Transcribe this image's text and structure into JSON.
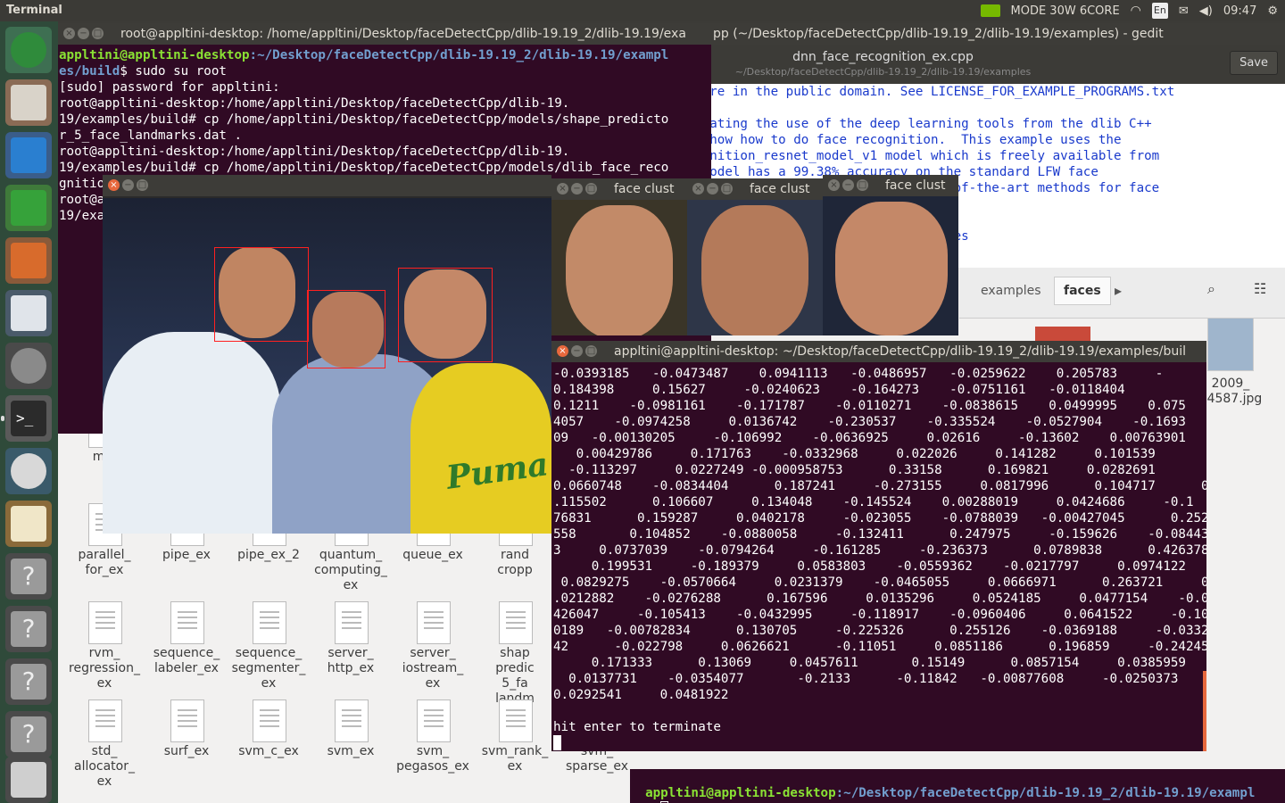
{
  "topbar": {
    "app_name": "Terminal",
    "mode": "MODE 30W 6CORE",
    "lang": "En",
    "time": "09:47"
  },
  "launcher": {
    "items": [
      "ubuntu-dash",
      "files",
      "writer",
      "calc",
      "impress",
      "software-center",
      "system-settings",
      "terminal",
      "software-updater",
      "text-editor",
      "unknown-1",
      "unknown-2",
      "unknown-3",
      "unknown-4",
      "trash"
    ]
  },
  "bg_terminal": {
    "title": "root@appltini-desktop: /home/appltini/Desktop/faceDetectCpp/dlib-19.19_2/dlib-19.19/exa",
    "prompt_user": "appltini@appltini-desktop",
    "prompt_path": ":~/Desktop/faceDetectCpp/dlib-19.19_2/dlib-19.19/exampl",
    "prompt_path2": "es/build",
    "prompt_cmd": "$ sudo su root",
    "lines": [
      "[sudo] password for appltini:",
      "root@appltini-desktop:/home/appltini/Desktop/faceDetectCpp/dlib-19.",
      "19/examples/build# cp /home/appltini/Desktop/faceDetectCpp/models/shape_predicto",
      "r_5_face_landmarks.dat .",
      "root@appltini-desktop:/home/appltini/Desktop/faceDetectCpp/dlib-19.",
      "19/examples/build# cp /home/appltini/Desktop/faceDetectCpp/models/dlib_face_reco",
      "gnitio",
      "root@a",
      "19/exa"
    ]
  },
  "gedit": {
    "title": "pp (~/Desktop/faceDetectCpp/dlib-19.19_2/dlib-19.19/examples) - gedit",
    "filename": "dnn_face_recognition_ex.cpp",
    "path": "~/Desktop/faceDetectCpp/dlib-19.19_2/dlib-19.19/examples",
    "save_label": "Save",
    "lines": [
      "// The contents of this file are in the public domain. See LICENSE_FOR_EXAMPLE_PROGRAMS.txt",
      "",
      "    This is an example illustrating the use of the deep learning tools from the dlib C++",
      "    library.  In it, we will show how to do face recognition.  This example uses the",
      "    pretrained dlib_face_recognition_resnet_model_v1 model which is freely available from",
      "    the dlib web site.  This model has a 99.38% accuracy on the standard LFW face",
      "    recognition benchmark, which is comparable to other state-of-the-art methods for face",
      "",
      "",
      "    You should also read the examples.  Included in the examples"
    ]
  },
  "files": {
    "breadcrumb": [
      "examples",
      "faces"
    ],
    "right_item": {
      "label": "2009_\n04587.jpg"
    },
    "items": [
      {
        "label": "mlp",
        "col": 0,
        "row": 0
      },
      {
        "label": "parallel_\nfor_ex",
        "col": 0,
        "row": 1
      },
      {
        "label": "pipe_ex",
        "col": 1,
        "row": 1
      },
      {
        "label": "pipe_ex_2",
        "col": 2,
        "row": 1
      },
      {
        "label": "quantum_\ncomputing_\nex",
        "col": 3,
        "row": 1
      },
      {
        "label": "queue_ex",
        "col": 4,
        "row": 1
      },
      {
        "label": "rand\ncropp",
        "col": 5,
        "row": 1
      },
      {
        "label": "rvm_\nregression_\nex",
        "col": 0,
        "row": 2
      },
      {
        "label": "sequence_\nlabeler_ex",
        "col": 1,
        "row": 2
      },
      {
        "label": "sequence_\nsegmenter_\nex",
        "col": 2,
        "row": 2
      },
      {
        "label": "server_\nhttp_ex",
        "col": 3,
        "row": 2
      },
      {
        "label": "server_\niostream_\nex",
        "col": 4,
        "row": 2
      },
      {
        "label": "shap\npredic\n5_fa\nlandm\nda",
        "col": 5,
        "row": 2
      },
      {
        "label": "std_\nallocator_\nex",
        "col": 0,
        "row": 3
      },
      {
        "label": "surf_ex",
        "col": 1,
        "row": 3
      },
      {
        "label": "svm_c_ex",
        "col": 2,
        "row": 3
      },
      {
        "label": "svm_ex",
        "col": 3,
        "row": 3
      },
      {
        "label": "svm_\npegasos_ex",
        "col": 4,
        "row": 3
      },
      {
        "label": "svm_rank_\nex",
        "col": 5,
        "row": 3
      },
      {
        "label": "svm_\nsparse_ex",
        "col": 6,
        "row": 3
      }
    ]
  },
  "face_window": {
    "title": ""
  },
  "clusters": [
    {
      "title": "face clust"
    },
    {
      "title": "face clust"
    },
    {
      "title": "face clust"
    }
  ],
  "output_terminal": {
    "title": "appltini@appltini-desktop: ~/Desktop/faceDetectCpp/dlib-19.19_2/dlib-19.19/examples/buil",
    "lines": [
      "-0.0393185   -0.0473487    0.0941113   -0.0486957   -0.0259622    0.205783     -",
      "0.184398     0.15627     -0.0240623    -0.164273    -0.0751161   -0.0118404",
      "0.1211    -0.0981161    -0.171787    -0.0110271    -0.0838615    0.0499995    0.075",
      "4057    -0.0974258     0.0136742    -0.230537    -0.335524    -0.0527904    -0.1693",
      "09   -0.00130205     -0.106992    -0.0636925     0.02616     -0.13602    0.00763901",
      "   0.00429786     0.171763    -0.0332968     0.022026     0.141282     0.101539",
      "  -0.113297     0.0227249 -0.000958753      0.33158      0.169821     0.0282691",
      "0.0660748    -0.0834404      0.187241     -0.273155     0.0817996      0.104717      0",
      ".115502      0.106607     0.134048    -0.145524    0.00288019     0.0424686     -0.1",
      "76831      0.159287     0.0402178     -0.023055    -0.0788039   -0.00427045      0.252",
      "558       0.104852    -0.0880058     -0.132411      0.247975     -0.159626    -0.084435",
      "3     0.0737039    -0.0794264     -0.161285     -0.236373      0.0789838      0.426378",
      "     0.199531     -0.189379     0.0583803    -0.0559362    -0.0217797     0.0974122",
      " 0.0829275    -0.0570664     0.0231379    -0.0465055     0.0666971      0.263721     0",
      ".0212882    -0.0276288      0.167596     0.0135296     0.0524185     0.0477154    -0.00",
      "426047     -0.105413    -0.0432995     -0.118917    -0.0960406     0.0641522     -0.10",
      "0189   -0.00782834      0.130705     -0.225326      0.255126    -0.0369188     -0.03320",
      "42      -0.022798     0.0626621      -0.11051     0.0851186      0.196859     -0.242454",
      "     0.171333      0.13069     0.0457611       0.15149      0.0857154     0.0385959",
      "  0.0137731    -0.0354077       -0.2133      -0.11842   -0.00877608     -0.0250373",
      "0.0292541     0.0481922",
      "",
      "hit enter to terminate"
    ]
  },
  "bottom_terminal": {
    "user": "appltini@appltini-desktop",
    "path": ":~/Desktop/faceDetectCpp/dlib-19.19_2/dlib-19.19/exampl",
    "path2": "es"
  }
}
